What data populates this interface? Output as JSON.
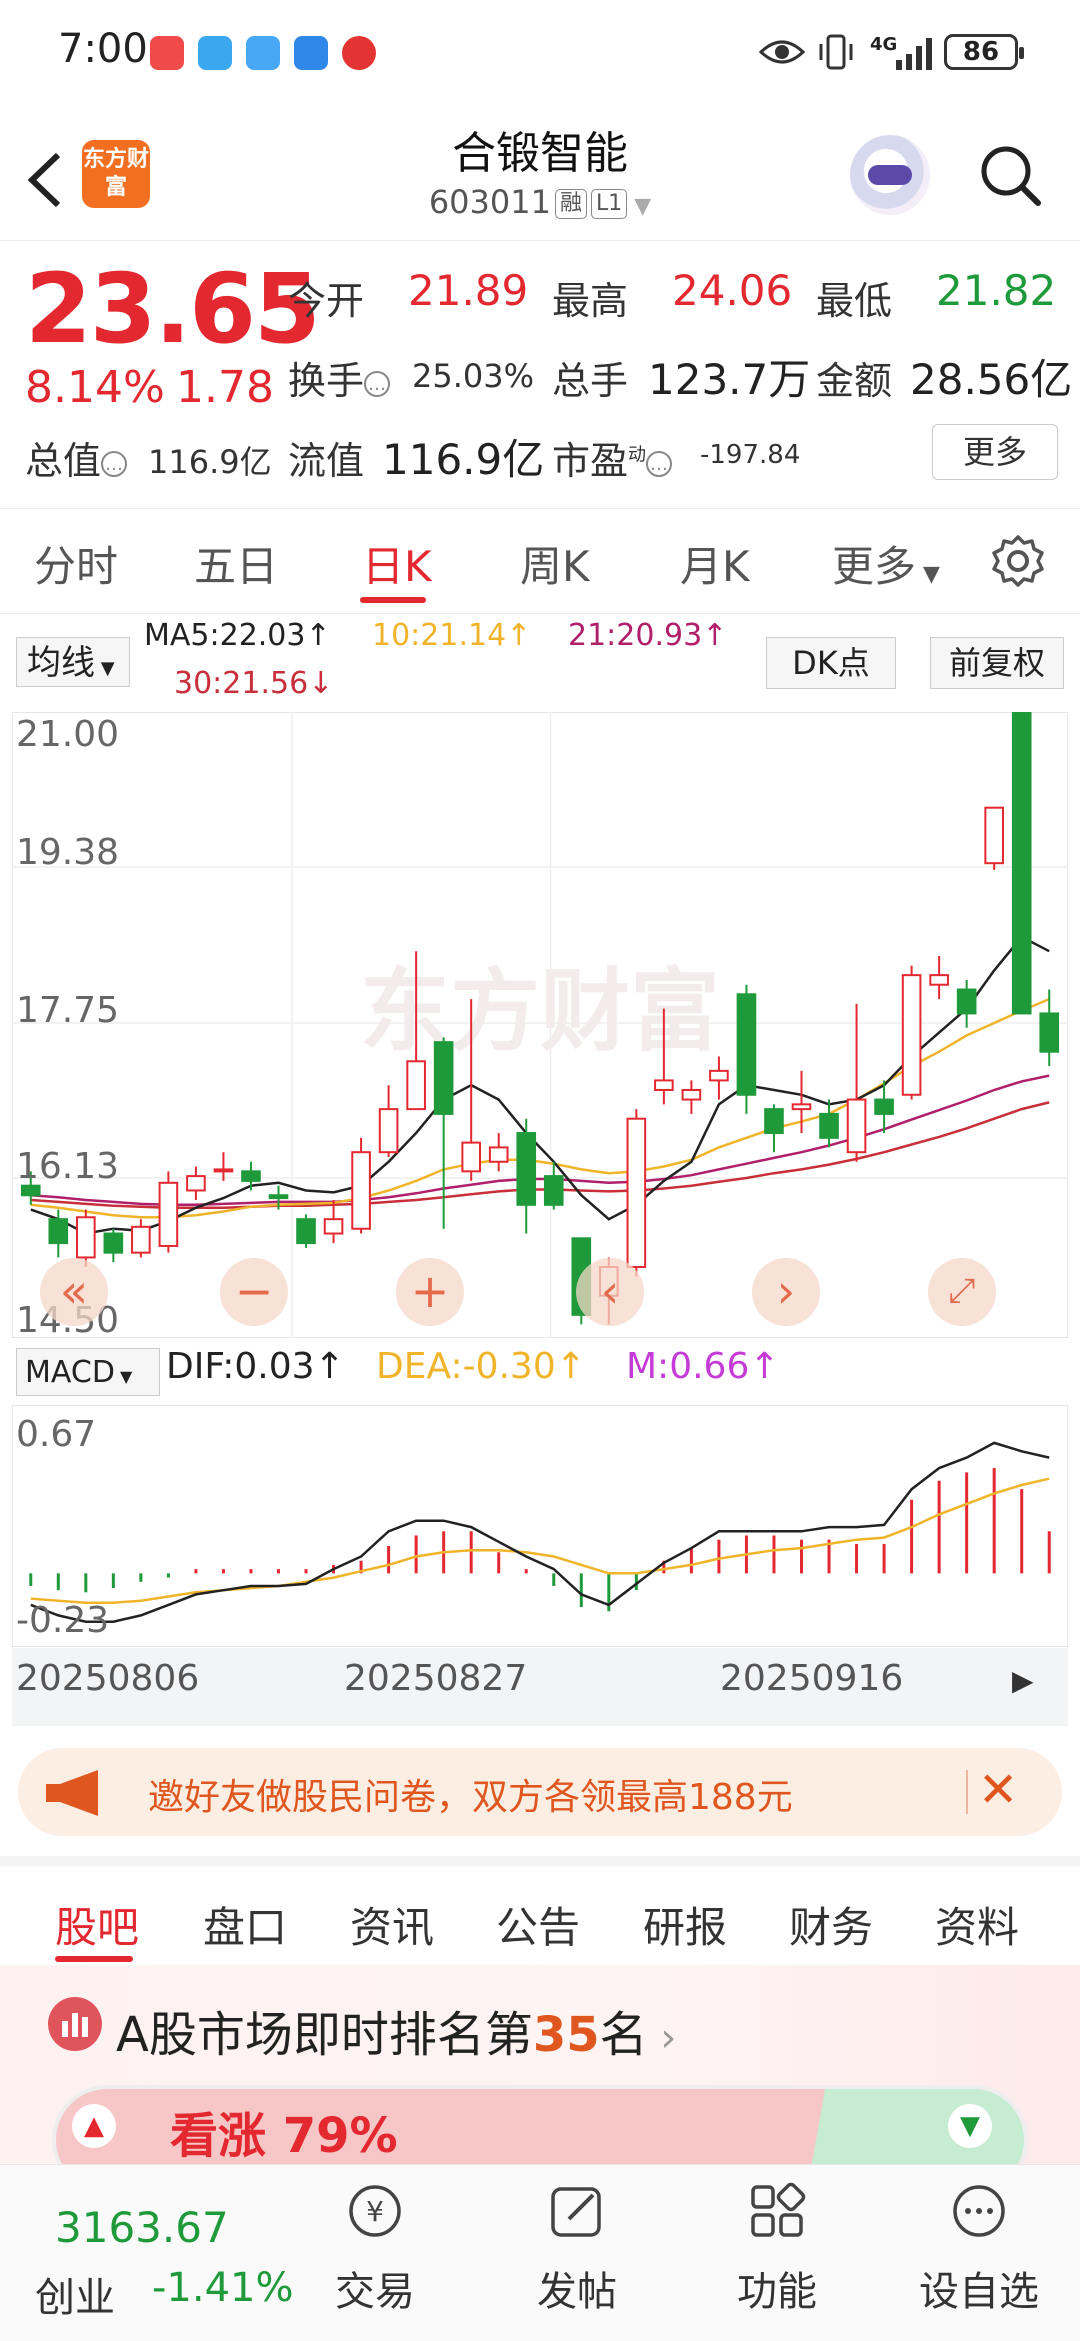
{
  "status_bar": {
    "time": "7:00",
    "battery": "86",
    "network": "4G"
  },
  "header": {
    "stock_name": "合锻智能",
    "stock_code": "603011",
    "tag_margin": "融",
    "tag_level": "L1",
    "brand_logo_text": "东方财富"
  },
  "quote": {
    "price": "23.65",
    "change_pct": "8.14%",
    "change_amt": "1.78",
    "open_label": "今开",
    "open": "21.89",
    "high_label": "最高",
    "high": "24.06",
    "low_label": "最低",
    "low": "21.82",
    "turnover_label": "换手",
    "turnover": "25.03%",
    "volume_label": "总手",
    "volume": "123.7万",
    "amount_label": "金额",
    "amount": "28.56亿",
    "mktcap_label": "总值",
    "mktcap": "116.9亿",
    "float_label": "流值",
    "float_cap": "116.9亿",
    "pe_label": "市盈",
    "pe_superscript": "动",
    "pe": "-197.84",
    "more_label": "更多"
  },
  "period_tabs": [
    "分时",
    "五日",
    "日K",
    "周K",
    "月K",
    "更多"
  ],
  "active_period": "日K",
  "ma_legend": {
    "selector": "均线",
    "ma5": "MA5:22.03↑",
    "ma10": "10:21.14↑",
    "ma21": "21:20.93↑",
    "ma30": "30:21.56↓",
    "dk_label": "DK点",
    "fq_label": "前复权"
  },
  "kline_axis": {
    "ticks": [
      "21.00",
      "19.38",
      "17.75",
      "16.13",
      "14.50"
    ]
  },
  "macd_legend": {
    "selector": "MACD",
    "dif": "DIF:0.03↑",
    "dea": "DEA:-0.30↑",
    "m": "M:0.66↑"
  },
  "macd_axis": {
    "ticks": [
      "0.67",
      "-0.23"
    ]
  },
  "dates": [
    "20250806",
    "20250827",
    "20250916"
  ],
  "watermark": "东方财富",
  "colors": {
    "up": "#e3282f",
    "down": "#1f9a3a",
    "ma5": "#222222",
    "ma10": "#f0b42a",
    "ma21": "#b0206a",
    "ma30": "#c82f3a"
  },
  "chart_data": {
    "type": "candlestick",
    "ylim": [
      14.5,
      21.0
    ],
    "candles": [
      {
        "o": 16.05,
        "c": 15.95,
        "h": 16.2,
        "l": 15.85
      },
      {
        "o": 15.7,
        "c": 15.45,
        "h": 15.8,
        "l": 15.3
      },
      {
        "o": 15.3,
        "c": 15.72,
        "h": 15.8,
        "l": 15.2
      },
      {
        "o": 15.55,
        "c": 15.35,
        "h": 15.6,
        "l": 15.25
      },
      {
        "o": 15.35,
        "c": 15.62,
        "h": 15.7,
        "l": 15.3
      },
      {
        "o": 15.42,
        "c": 16.08,
        "h": 16.2,
        "l": 15.35
      },
      {
        "o": 16.0,
        "c": 16.15,
        "h": 16.25,
        "l": 15.9
      },
      {
        "o": 16.22,
        "c": 16.22,
        "h": 16.4,
        "l": 16.1
      },
      {
        "o": 16.2,
        "c": 16.1,
        "h": 16.3,
        "l": 16.0
      },
      {
        "o": 15.95,
        "c": 15.92,
        "h": 16.05,
        "l": 15.8
      },
      {
        "o": 15.7,
        "c": 15.45,
        "h": 15.75,
        "l": 15.4
      },
      {
        "o": 15.55,
        "c": 15.7,
        "h": 15.9,
        "l": 15.45
      },
      {
        "o": 15.6,
        "c": 16.4,
        "h": 16.55,
        "l": 15.55
      },
      {
        "o": 16.4,
        "c": 16.85,
        "h": 17.1,
        "l": 16.35
      },
      {
        "o": 16.85,
        "c": 17.35,
        "h": 18.5,
        "l": 16.85
      },
      {
        "o": 17.55,
        "c": 16.8,
        "h": 17.6,
        "l": 15.6
      },
      {
        "o": 16.2,
        "c": 16.5,
        "h": 18.0,
        "l": 16.1
      },
      {
        "o": 16.3,
        "c": 16.45,
        "h": 16.6,
        "l": 16.2
      },
      {
        "o": 16.6,
        "c": 15.85,
        "h": 16.75,
        "l": 15.55
      },
      {
        "o": 16.15,
        "c": 15.85,
        "h": 16.3,
        "l": 15.8
      },
      {
        "o": 15.5,
        "c": 14.7,
        "h": 15.5,
        "l": 14.6
      },
      {
        "o": 14.9,
        "c": 15.2,
        "h": 15.3,
        "l": 14.6
      },
      {
        "o": 15.2,
        "c": 16.75,
        "h": 16.85,
        "l": 15.1
      },
      {
        "o": 17.05,
        "c": 17.15,
        "h": 17.9,
        "l": 16.9
      },
      {
        "o": 16.95,
        "c": 17.05,
        "h": 17.15,
        "l": 16.8
      },
      {
        "o": 17.15,
        "c": 17.25,
        "h": 17.4,
        "l": 16.95
      },
      {
        "o": 18.05,
        "c": 17.0,
        "h": 18.15,
        "l": 16.8
      },
      {
        "o": 16.85,
        "c": 16.6,
        "h": 16.9,
        "l": 16.4
      },
      {
        "o": 16.85,
        "c": 16.9,
        "h": 17.25,
        "l": 16.6
      },
      {
        "o": 16.8,
        "c": 16.55,
        "h": 16.95,
        "l": 16.45
      },
      {
        "o": 16.4,
        "c": 16.95,
        "h": 17.95,
        "l": 16.3
      },
      {
        "o": 16.95,
        "c": 16.8,
        "h": 17.15,
        "l": 16.6
      },
      {
        "o": 17.0,
        "c": 18.25,
        "h": 18.35,
        "l": 16.95
      },
      {
        "o": 18.15,
        "c": 18.25,
        "h": 18.45,
        "l": 18.0
      },
      {
        "o": 18.1,
        "c": 17.85,
        "h": 18.2,
        "l": 17.7
      },
      {
        "o": 19.42,
        "c": 20.0,
        "h": 20.0,
        "l": 19.35
      },
      {
        "o": 21.0,
        "c": 17.85,
        "h": 21.05,
        "l": 17.85
      },
      {
        "o": 17.85,
        "c": 17.45,
        "h": 18.1,
        "l": 17.3
      }
    ],
    "ma5": [
      15.8,
      15.7,
      15.55,
      15.6,
      15.58,
      15.68,
      15.82,
      15.92,
      16.05,
      16.08,
      16.0,
      15.98,
      16.05,
      16.3,
      16.6,
      16.95,
      17.1,
      16.95,
      16.6,
      16.3,
      15.95,
      15.7,
      15.85,
      16.1,
      16.3,
      16.9,
      17.1,
      17.05,
      17.0,
      16.9,
      16.95,
      17.1,
      17.4,
      17.65,
      17.9,
      18.3,
      18.65,
      18.5
    ],
    "ma10": [
      15.85,
      15.82,
      15.78,
      15.74,
      15.72,
      15.72,
      15.74,
      15.78,
      15.83,
      15.85,
      15.86,
      15.87,
      15.92,
      16.0,
      16.1,
      16.22,
      16.28,
      16.32,
      16.32,
      16.28,
      16.22,
      16.18,
      16.2,
      16.25,
      16.32,
      16.45,
      16.55,
      16.65,
      16.72,
      16.8,
      16.95,
      17.12,
      17.3,
      17.45,
      17.62,
      17.75,
      17.88,
      18.0
    ],
    "ma21": [
      15.95,
      15.93,
      15.9,
      15.88,
      15.86,
      15.85,
      15.85,
      15.86,
      15.87,
      15.88,
      15.88,
      15.88,
      15.9,
      15.93,
      15.97,
      16.02,
      16.06,
      16.1,
      16.12,
      16.12,
      16.1,
      16.08,
      16.09,
      16.12,
      16.16,
      16.22,
      16.28,
      16.34,
      16.4,
      16.47,
      16.55,
      16.64,
      16.74,
      16.84,
      16.94,
      17.05,
      17.14,
      17.2
    ],
    "ma30": [
      15.9,
      15.88,
      15.86,
      15.84,
      15.83,
      15.82,
      15.82,
      15.82,
      15.83,
      15.84,
      15.84,
      15.85,
      15.86,
      15.88,
      15.9,
      15.93,
      15.96,
      15.99,
      16.01,
      16.01,
      16.0,
      15.99,
      16.0,
      16.02,
      16.05,
      16.09,
      16.13,
      16.18,
      16.22,
      16.27,
      16.33,
      16.4,
      16.48,
      16.56,
      16.65,
      16.75,
      16.85,
      16.92
    ],
    "macd": {
      "ylim": [
        -0.35,
        0.8
      ],
      "dif": [
        -0.15,
        -0.2,
        -0.23,
        -0.23,
        -0.2,
        -0.15,
        -0.1,
        -0.08,
        -0.06,
        -0.06,
        -0.05,
        0.02,
        0.08,
        0.2,
        0.25,
        0.25,
        0.22,
        0.15,
        0.08,
        0.02,
        -0.1,
        -0.15,
        -0.05,
        0.05,
        0.12,
        0.2,
        0.2,
        0.2,
        0.2,
        0.22,
        0.22,
        0.23,
        0.4,
        0.5,
        0.55,
        0.62,
        0.58,
        0.55
      ],
      "dea": [
        -0.12,
        -0.13,
        -0.14,
        -0.14,
        -0.13,
        -0.11,
        -0.09,
        -0.08,
        -0.07,
        -0.06,
        -0.04,
        -0.02,
        0.01,
        0.04,
        0.08,
        0.1,
        0.11,
        0.11,
        0.1,
        0.08,
        0.04,
        0.0,
        0.0,
        0.02,
        0.04,
        0.07,
        0.09,
        0.11,
        0.12,
        0.14,
        0.16,
        0.17,
        0.22,
        0.28,
        0.33,
        0.38,
        0.42,
        0.45
      ],
      "hist": [
        -0.06,
        -0.08,
        -0.09,
        -0.07,
        -0.04,
        -0.02,
        0.02,
        0.02,
        0.02,
        0.02,
        0.02,
        0.04,
        0.06,
        0.13,
        0.18,
        0.2,
        0.2,
        0.1,
        0.02,
        -0.06,
        -0.16,
        -0.18,
        -0.08,
        0.06,
        0.12,
        0.16,
        0.18,
        0.18,
        0.16,
        0.16,
        0.14,
        0.14,
        0.35,
        0.44,
        0.48,
        0.5,
        0.4,
        0.2
      ]
    }
  },
  "promo": {
    "text": "邀好友做股民问卷，双方各领最高188元"
  },
  "content_tabs": [
    "股吧",
    "盘口",
    "资讯",
    "公告",
    "研报",
    "财务",
    "资料"
  ],
  "active_content_tab": "股吧",
  "ranking": {
    "prefix": "A股市场即时排名第",
    "rank": "35",
    "suffix": "名",
    "sentiment_label": "看涨 79%"
  },
  "bottom_nav": {
    "index_value": "3163.67",
    "index_name": "创业",
    "index_change": "-1.41%",
    "items": [
      "交易",
      "发帖",
      "功能",
      "设自选"
    ]
  }
}
